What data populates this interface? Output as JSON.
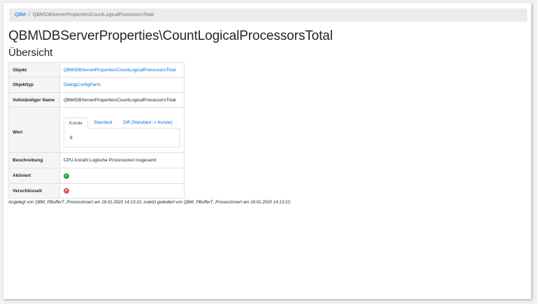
{
  "breadcrumb": {
    "root": "QBM",
    "separator": "/",
    "current": "QBM\\DBServerProperties\\CountLogicalProcessorsTotal"
  },
  "page_title": "QBM\\DBServerProperties\\CountLogicalProcessorsTotal",
  "section_title": "Übersicht",
  "properties": {
    "objekt": {
      "label": "Objekt",
      "value": "QBM\\DBServerProperties\\CountLogicalProcessorsTotal"
    },
    "objekttyp": {
      "label": "Objekttyp",
      "value": "DialogConfigParm"
    },
    "vollstaendiger_name": {
      "label": "Vollständiger Name",
      "value": "QBM\\DBServerProperties\\CountLogicalProcessorsTotal"
    },
    "wert": {
      "label": "Wert",
      "tabs": [
        "Kunde",
        "Standard",
        "Diff (Standard -> Kunde)"
      ],
      "active_tab": "Kunde",
      "value": "8"
    },
    "beschreibung": {
      "label": "Beschreibung",
      "value": "CPU Anzahl Logische Prozessoren insgesamt"
    },
    "aktiviert": {
      "label": "Aktiviert",
      "icon": "check-circle-icon",
      "state": true,
      "color": "#28a745"
    },
    "verschluesselt": {
      "label": "Verschlüsselt",
      "icon": "x-circle-icon",
      "state": false,
      "color": "#d9534f"
    }
  },
  "footer_note": "Angelegt von QBM_PBufferT_ProcessInsert am 18.01.2020 14:13:10, zuletzt geändert von QBM_PBufferT_ProcessInsert am 18.01.2020 14:13:10.",
  "colors": {
    "link": "#0a6ed1",
    "breadcrumb_bg": "#e9ecef",
    "key_bg": "#f5f5f5"
  }
}
